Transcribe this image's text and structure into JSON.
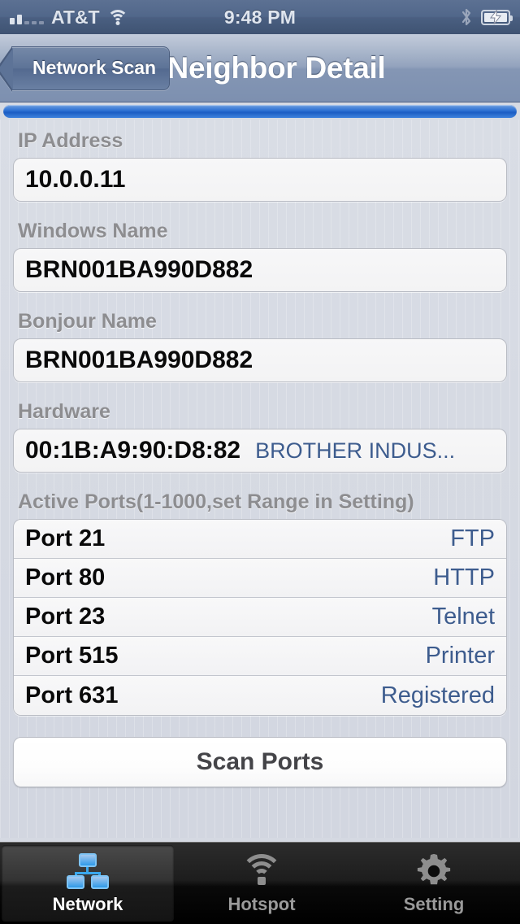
{
  "status_bar": {
    "signal_icon": "signal-bars-icon",
    "signal_bars_filled": 2,
    "signal_bars_total": 5,
    "carrier": "AT&T",
    "wifi_icon": "wifi-icon",
    "time": "9:48 PM",
    "bluetooth_icon": "bluetooth-icon",
    "battery_icon": "battery-charging-icon"
  },
  "nav_bar": {
    "back_label": "Network Scan",
    "title": "Neighbor Detail",
    "back_icon": "chevron-left-icon"
  },
  "progress": {
    "percent": 100
  },
  "fields": [
    {
      "label": "IP Address",
      "value": "10.0.0.11",
      "vendor": ""
    },
    {
      "label": "Windows Name",
      "value": "BRN001BA990D882",
      "vendor": ""
    },
    {
      "label": "Bonjour Name",
      "value": "BRN001BA990D882",
      "vendor": ""
    },
    {
      "label": "Hardware",
      "value": "00:1B:A9:90:D8:82",
      "vendor": "BROTHER INDUS..."
    }
  ],
  "ports_section": {
    "label": "Active Ports(1-1000,set Range in Setting)",
    "rows": [
      {
        "port": "Port 21",
        "service": "FTP"
      },
      {
        "port": "Port 80",
        "service": "HTTP"
      },
      {
        "port": "Port 23",
        "service": "Telnet"
      },
      {
        "port": "Port 515",
        "service": "Printer"
      },
      {
        "port": "Port 631",
        "service": "Registered"
      }
    ]
  },
  "scan_button": {
    "label": "Scan Ports"
  },
  "tab_bar": {
    "tabs": [
      {
        "label": "Network",
        "icon": "network-topology-icon",
        "active": true
      },
      {
        "label": "Hotspot",
        "icon": "wifi-icon",
        "active": false
      },
      {
        "label": "Setting",
        "icon": "gear-icon",
        "active": false
      }
    ]
  },
  "colors": {
    "accent_blue": "#2f72d4",
    "service_blue": "#3d5c8e",
    "label_gray": "#8d8d90",
    "navbar_blue": "#8496b4",
    "background": "#d5d9e2"
  }
}
